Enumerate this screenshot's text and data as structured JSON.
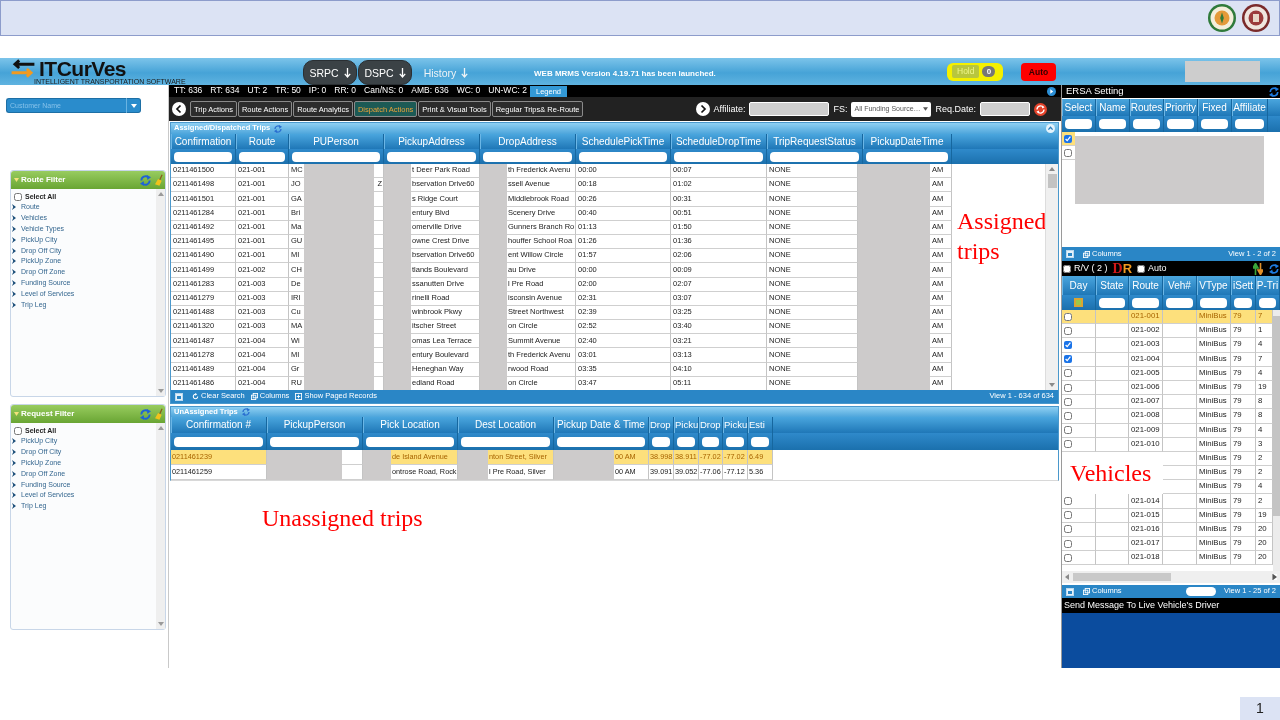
{
  "slide": {
    "page_number": "1"
  },
  "header": {
    "logo": {
      "wordmark": "ITCurVes",
      "tagline": "INTELLIGENT TRANSPORTATION SOFTWARE"
    },
    "nav": [
      {
        "label": "SRPC",
        "kind": "pill"
      },
      {
        "label": "DSPC",
        "kind": "pill"
      },
      {
        "label": "History",
        "kind": "plain"
      }
    ],
    "message": "WEB MRMS Version 4.19.71 has been launched.",
    "hold": {
      "label": "Hold",
      "count": "0"
    },
    "auto_button": "Auto"
  },
  "sidebar": {
    "customer": {
      "placeholder": "Customer Name"
    },
    "filters": [
      {
        "title": "Route Filter",
        "select_all": {
          "label": "Select All",
          "checked": false
        },
        "items": [
          "Route",
          "Vehicles",
          "Vehicle Types",
          "PickUp City",
          "Drop Off City",
          "PickUp Zone",
          "Drop Off Zone",
          "Funding Source",
          "Level of Services",
          "Trip Leg"
        ]
      },
      {
        "title": "Request Filter",
        "select_all": {
          "label": "Select All",
          "checked": false
        },
        "items": [
          "PickUp City",
          "Drop Off City",
          "PickUp Zone",
          "Drop Off Zone",
          "Funding Source",
          "Level of Services",
          "Trip Leg"
        ]
      }
    ]
  },
  "stats_bar": {
    "stats": [
      {
        "label": "TT:",
        "value": "636"
      },
      {
        "label": "RT:",
        "value": "634"
      },
      {
        "label": "UT:",
        "value": "2"
      },
      {
        "label": "TR:",
        "value": "50"
      },
      {
        "label": "IP:",
        "value": "0"
      },
      {
        "label": "RR:",
        "value": "0"
      },
      {
        "label": "Can/NS:",
        "value": "0"
      },
      {
        "label": "AMB:",
        "value": "636"
      },
      {
        "label": "WC:",
        "value": "0"
      },
      {
        "label": "UN-WC:",
        "value": "2"
      }
    ],
    "legend_button": "Legend"
  },
  "toolbar": {
    "tabs": [
      {
        "label": "Trip Actions",
        "selected": false
      },
      {
        "label": "Route Actions",
        "selected": false
      },
      {
        "label": "Route Analytics",
        "selected": false
      },
      {
        "label": "Dispatch Actions",
        "selected": true
      },
      {
        "label": "Print & Visual Tools",
        "selected": false
      },
      {
        "label": "Regular Trips& Re-Route",
        "selected": false
      }
    ],
    "affiliate_label": "Affiliate:",
    "fs_label": "FS:",
    "fs_value": "All Funding Source…",
    "req_date_label": "Req.Date:"
  },
  "assigned_trips": {
    "title": "Assigned/Dispatched Trips",
    "columns": [
      "Confirmation",
      "Route",
      "PUPerson",
      "PickupAddress",
      "DropAddress",
      "SchedulePickTime",
      "ScheduleDropTime",
      "TripRequestStatus",
      "PickupDateTime"
    ],
    "rows": [
      {
        "cells": [
          "0211461500",
          "021-001",
          "MC",
          "t Deer Park Road",
          "th Frederick Avenu",
          "00:00",
          "00:07",
          "NONE",
          "AM"
        ]
      },
      {
        "cells": [
          "0211461498",
          "021-001",
          "JO",
          "bservation Drive60",
          "ssell Avenue",
          "00:18",
          "01:02",
          "NONE",
          "AM"
        ],
        "pu_person_end": "Z"
      },
      {
        "cells": [
          "0211461501",
          "021-001",
          "GA",
          "s Ridge Court",
          "Middlebrook Road",
          "00:26",
          "00:31",
          "NONE",
          "AM"
        ]
      },
      {
        "cells": [
          "0211461284",
          "021-001",
          "Bri",
          "entury Blvd",
          "Scenery Drive",
          "00:40",
          "00:51",
          "NONE",
          "AM"
        ]
      },
      {
        "cells": [
          "0211461492",
          "021-001",
          "Ma",
          "omerville Drive",
          "Gunners Branch Ro",
          "01:13",
          "01:50",
          "NONE",
          "AM"
        ]
      },
      {
        "cells": [
          "0211461495",
          "021-001",
          "GU",
          "owne Crest Drive",
          "houffer School Roa",
          "01:26",
          "01:36",
          "NONE",
          "AM"
        ]
      },
      {
        "cells": [
          "0211461490",
          "021-001",
          "MI",
          "bservation Drive60",
          "ent Willow Circle",
          "01:57",
          "02:06",
          "NONE",
          "AM"
        ]
      },
      {
        "cells": [
          "0211461499",
          "021-002",
          "CH",
          "tlands Boulevard",
          "au Drive",
          "00:00",
          "00:09",
          "NONE",
          "AM"
        ]
      },
      {
        "cells": [
          "0211461283",
          "021-003",
          "De",
          "ssanutten Drive",
          "l Pre Road",
          "02:00",
          "02:07",
          "NONE",
          "AM"
        ]
      },
      {
        "cells": [
          "0211461279",
          "021-003",
          "IRI",
          "rinelli Road",
          "isconsin Avenue",
          "02:31",
          "03:07",
          "NONE",
          "AM"
        ]
      },
      {
        "cells": [
          "0211461488",
          "021-003",
          "Cu",
          "winbrook Pkwy",
          "Street Northwest",
          "02:39",
          "03:25",
          "NONE",
          "AM"
        ]
      },
      {
        "cells": [
          "0211461320",
          "021-003",
          "MA",
          "itscher Street",
          "on Circle",
          "02:52",
          "03:40",
          "NONE",
          "AM"
        ]
      },
      {
        "cells": [
          "0211461487",
          "021-004",
          "Wi",
          "omas Lea Terrace",
          "Summit Avenue",
          "02:40",
          "03:21",
          "NONE",
          "AM"
        ]
      },
      {
        "cells": [
          "0211461278",
          "021-004",
          "MI",
          "entury Boulevard",
          "th Frederick Avenu",
          "03:01",
          "03:13",
          "NONE",
          "AM"
        ]
      },
      {
        "cells": [
          "0211461489",
          "021-004",
          "Gr",
          "Heneghan Way",
          "rwood Road",
          "03:35",
          "04:10",
          "NONE",
          "AM"
        ]
      },
      {
        "cells": [
          "0211461486",
          "021-004",
          "RU",
          "edland Road",
          "on Circle",
          "03:47",
          "05:11",
          "NONE",
          "AM"
        ]
      }
    ],
    "footer": {
      "actions": [
        {
          "label": "Clear Search",
          "kind": "clear"
        },
        {
          "label": "Columns",
          "kind": "columns"
        },
        {
          "label": "Show Paged Records",
          "kind": "paged"
        }
      ],
      "view": "View 1 - 634 of 634"
    },
    "annotation": "Assigned trips"
  },
  "unassigned_trips": {
    "title": "UnAssigned Trips",
    "columns": [
      "Confirmation #",
      "PickupPerson",
      "Pick Location",
      "Dest Location",
      "Pickup Date & Time",
      "Drop",
      "Picku",
      "Drop",
      "Picku",
      "Esti"
    ],
    "rows": [
      {
        "selected": true,
        "confirmation": "0211461239",
        "pick_location": "de Island Avenue",
        "dest_location": "nton Street, Silver",
        "pickup_date_time": "00 AM",
        "values": [
          "38.998",
          "38.911",
          "-77.02",
          "-77.02",
          "6.49"
        ]
      },
      {
        "selected": false,
        "confirmation": "0211461259",
        "pick_location": "ontrose Road, Rock",
        "dest_location": "l Pre Road, Silver",
        "pickup_date_time": "00 AM",
        "values": [
          "39.091",
          "39.052",
          "-77.06",
          "-77.12",
          "5.36"
        ]
      }
    ],
    "annotation": "Unassigned trips"
  },
  "ersa": {
    "title": "ERSA Setting",
    "columns": [
      "Select",
      "Name",
      "Routes",
      "Priority",
      "Fixed",
      "Affiliate"
    ],
    "rows": [
      {
        "checked": true
      },
      {
        "checked": false
      }
    ],
    "footer": {
      "actions": [
        {
          "label": "Columns",
          "kind": "columns"
        }
      ],
      "view": "View 1 - 2 of 2"
    }
  },
  "vehicles": {
    "toolbar": {
      "rv": {
        "label": "R/V ( 2 )",
        "checked": false
      },
      "mode_letters": [
        "D",
        "R"
      ],
      "auto": {
        "label": "Auto",
        "checked": false
      }
    },
    "columns": [
      "Day",
      "State",
      "Route",
      "Veh#",
      "VType",
      "iSett",
      "P-Tri"
    ],
    "rows": [
      {
        "checked": false,
        "selected": true,
        "route": "021-001",
        "vtype": "MiniBus",
        "isett": "79",
        "p_tri": "7"
      },
      {
        "checked": false,
        "selected": false,
        "route": "021-002",
        "vtype": "MiniBus",
        "isett": "79",
        "p_tri": "1"
      },
      {
        "checked": true,
        "selected": false,
        "route": "021-003",
        "vtype": "MiniBus",
        "isett": "79",
        "p_tri": "4"
      },
      {
        "checked": true,
        "selected": false,
        "route": "021-004",
        "vtype": "MiniBus",
        "isett": "79",
        "p_tri": "7"
      },
      {
        "checked": false,
        "selected": false,
        "route": "021-005",
        "vtype": "MiniBus",
        "isett": "79",
        "p_tri": "4"
      },
      {
        "checked": false,
        "selected": false,
        "route": "021-006",
        "vtype": "MiniBus",
        "isett": "79",
        "p_tri": "19"
      },
      {
        "checked": false,
        "selected": false,
        "route": "021-007",
        "vtype": "MiniBus",
        "isett": "79",
        "p_tri": "8"
      },
      {
        "checked": false,
        "selected": false,
        "route": "021-008",
        "vtype": "MiniBus",
        "isett": "79",
        "p_tri": "8"
      },
      {
        "checked": false,
        "selected": false,
        "route": "021-009",
        "vtype": "MiniBus",
        "isett": "79",
        "p_tri": "4"
      },
      {
        "checked": false,
        "selected": false,
        "route": "021-010",
        "vtype": "MiniBus",
        "isett": "79",
        "p_tri": "3"
      },
      {
        "selected": false,
        "vtype": "MiniBus",
        "isett": "79",
        "p_tri": "2"
      },
      {
        "selected": false,
        "vtype": "MiniBus",
        "isett": "79",
        "p_tri": "2"
      },
      {
        "selected": false,
        "vtype": "MiniBus",
        "isett": "79",
        "p_tri": "4"
      },
      {
        "checked": false,
        "selected": false,
        "route": "021-014",
        "vtype": "MiniBus",
        "isett": "79",
        "p_tri": "2"
      },
      {
        "checked": false,
        "selected": false,
        "route": "021-015",
        "vtype": "MiniBus",
        "isett": "79",
        "p_tri": "19"
      },
      {
        "checked": false,
        "selected": false,
        "route": "021-016",
        "vtype": "MiniBus",
        "isett": "79",
        "p_tri": "20"
      },
      {
        "checked": false,
        "selected": false,
        "route": "021-017",
        "vtype": "MiniBus",
        "isett": "79",
        "p_tri": "20"
      },
      {
        "checked": false,
        "selected": false,
        "route": "021-018",
        "vtype": "MiniBus",
        "isett": "79",
        "p_tri": "20"
      }
    ],
    "footer": {
      "actions": [
        {
          "label": "Columns",
          "kind": "columns"
        }
      ],
      "view": "View 1 - 25 of 2"
    },
    "annotation": "Vehicles",
    "message_bar": "Send Message To Live Vehicle's Driver"
  }
}
